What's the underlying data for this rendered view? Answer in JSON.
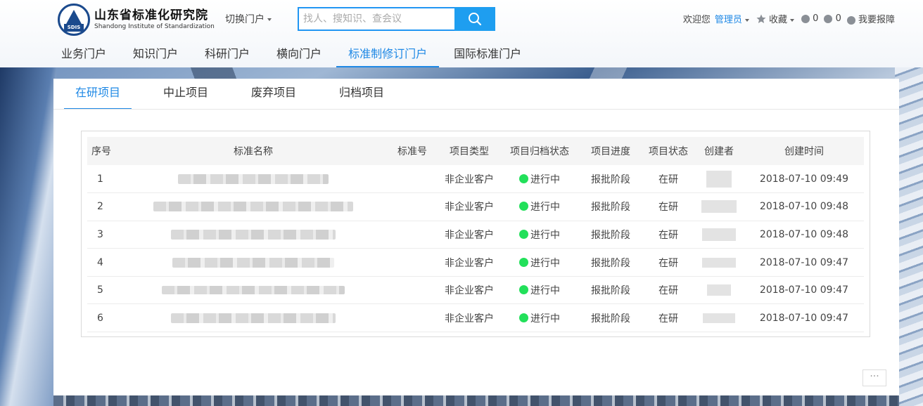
{
  "header": {
    "logo": {
      "cn": "山东省标准化研究院",
      "en": "Shandong Institute of Standardization",
      "mark": "SDIS"
    },
    "switch_portal": "切换门户",
    "search": {
      "placeholder": "找人、搜知识、查会议"
    },
    "user": {
      "welcome": "欢迎您",
      "name": "管理员",
      "favorites": "收藏",
      "count_a": "0",
      "count_b": "0",
      "report": "我要报障"
    }
  },
  "main_nav": {
    "items": [
      {
        "label": "业务门户"
      },
      {
        "label": "知识门户"
      },
      {
        "label": "科研门户"
      },
      {
        "label": "横向门户"
      },
      {
        "label": "标准制修订门户"
      },
      {
        "label": "国际标准门户"
      }
    ],
    "active_index": 4
  },
  "tabs": [
    {
      "label": "在研项目"
    },
    {
      "label": "中止项目"
    },
    {
      "label": "废弃项目"
    },
    {
      "label": "归档项目"
    }
  ],
  "table": {
    "headers": [
      "序号",
      "标准名称",
      "标准号",
      "项目类型",
      "项目归档状态",
      "项目进度",
      "项目状态",
      "创建者",
      "创建时间"
    ],
    "rows": [
      {
        "idx": "1",
        "type": "非企业客户",
        "archive": "进行中",
        "progress": "报批阶段",
        "status": "在研",
        "time": "2018-07-10 09:49"
      },
      {
        "idx": "2",
        "type": "非企业客户",
        "archive": "进行中",
        "progress": "报批阶段",
        "status": "在研",
        "time": "2018-07-10 09:48"
      },
      {
        "idx": "3",
        "type": "非企业客户",
        "archive": "进行中",
        "progress": "报批阶段",
        "status": "在研",
        "time": "2018-07-10 09:48"
      },
      {
        "idx": "4",
        "type": "非企业客户",
        "archive": "进行中",
        "progress": "报批阶段",
        "status": "在研",
        "time": "2018-07-10 09:47"
      },
      {
        "idx": "5",
        "type": "非企业客户",
        "archive": "进行中",
        "progress": "报批阶段",
        "status": "在研",
        "time": "2018-07-10 09:47"
      },
      {
        "idx": "6",
        "type": "非企业客户",
        "archive": "进行中",
        "progress": "报批阶段",
        "status": "在研",
        "time": "2018-07-10 09:47"
      }
    ]
  },
  "more_label": "···",
  "colors": {
    "accent": "#1e88e5",
    "status_dot": "#22e05a",
    "search_button": "#1e9ef0"
  }
}
